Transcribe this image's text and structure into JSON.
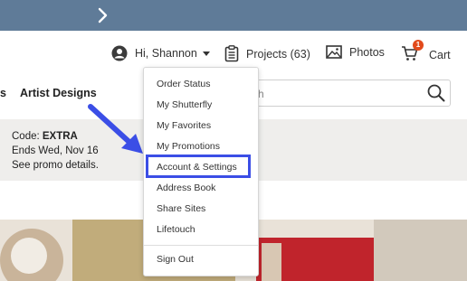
{
  "topbar": {
    "color": "#5f7b98",
    "icon": "chevron-right-icon"
  },
  "header": {
    "greeting": "Hi, Shannon",
    "projects_label": "Projects (63)",
    "photos_label": "Photos",
    "cart_label": "Cart",
    "cart_count": "1"
  },
  "nav": {
    "partial_item": "s",
    "artist_designs": "Artist Designs",
    "search_placeholder": "h"
  },
  "promo": {
    "code_prefix": "Code: ",
    "code_value": "EXTRA",
    "ends": "Ends Wed, Nov 16",
    "details": "See promo details."
  },
  "account_menu": {
    "items": [
      "Order Status",
      "My Shutterfly",
      "My Favorites",
      "My Promotions",
      "Account & Settings",
      "Address Book",
      "Share Sites",
      "Lifetouch"
    ],
    "sign_out": "Sign Out",
    "highlighted_item": "Account & Settings",
    "highlight_color": "#3b4ee6"
  }
}
